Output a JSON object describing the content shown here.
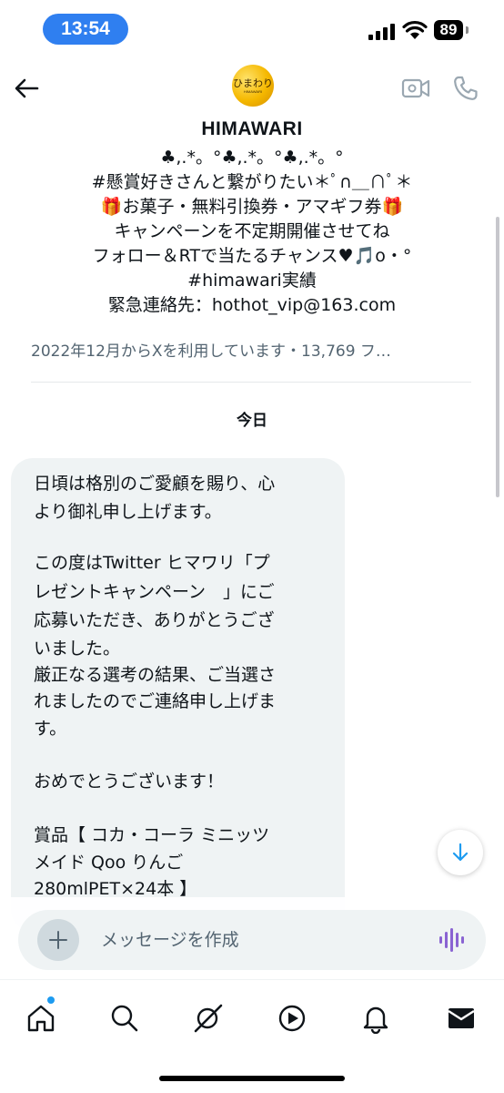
{
  "status_bar": {
    "time": "13:54",
    "battery": "89"
  },
  "header": {
    "back_icon": "back-arrow-icon",
    "video_icon": "video-camera-icon",
    "call_icon": "phone-icon",
    "avatar_text": "ひまわり",
    "avatar_subtext": "HIMAWARI"
  },
  "profile": {
    "name": "HIMAWARI",
    "bio_lines": [
      "♣,.*。°♣,.*。°♣,.*。°",
      "#懸賞好きさんと繋がりたい＊ﾟ∩＿∩ﾟ＊",
      "🎁お菓子・無料引換券・アマギフ券🎁",
      "キャンペーンを不定期開催させてね",
      "フォロー＆RTで当たるチャンス♥🎵o・°",
      "#himawari実績",
      "緊急連絡先：hothot_vip@163.com"
    ],
    "joined": "2022年12月からXを利用しています・13,769 フ…"
  },
  "conversation": {
    "day_label": "今日",
    "message_lines": [
      "日頃は格別のご愛顧を賜り、心",
      "より御礼申し上げます。",
      "",
      "この度はTwitter ヒマワリ「プ",
      "レゼントキャンペーン　」にご",
      "応募いただき、ありがとうござ",
      "いました。",
      "厳正なる選考の結果、ご当選さ",
      "れましたのでご連絡申し上げま",
      "す。",
      "",
      "おめでとうございます！",
      "",
      "賞品【 コカ・コーラ ミニッツ",
      "メイド Qoo りんご",
      "280mlPET×24本 】"
    ]
  },
  "composer": {
    "placeholder": "メッセージを作成",
    "add_icon": "plus-icon",
    "voice_icon": "voice-wave-icon"
  },
  "bottom_nav": {
    "items": [
      "home-icon",
      "search-icon",
      "grok-icon",
      "play-icon",
      "bell-icon",
      "mail-icon"
    ]
  },
  "colors": {
    "accent": "#1d9bf0",
    "time_pill": "#2f7ff0",
    "voice": "#8a63d2"
  }
}
